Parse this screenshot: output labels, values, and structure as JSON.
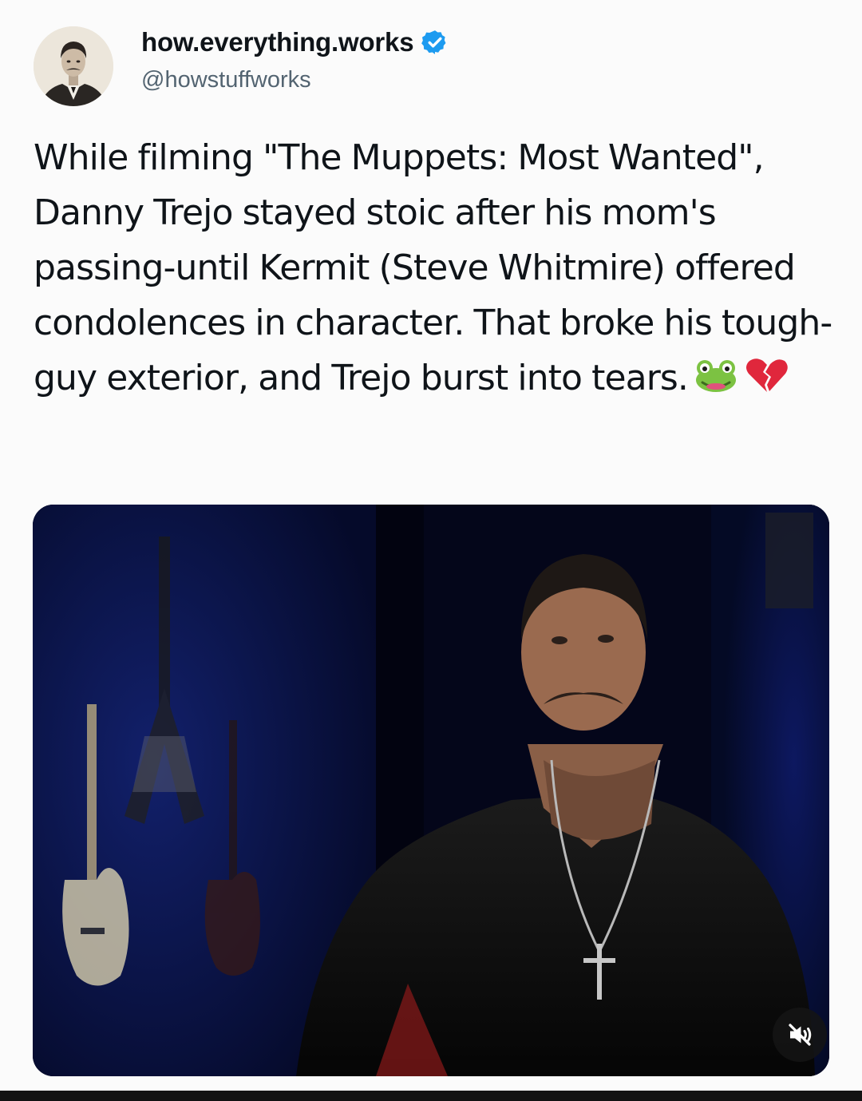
{
  "post": {
    "author": {
      "display_name": "how.everything.works",
      "handle": "@howstuffworks",
      "verified": true,
      "avatar": "vintage-portrait-avatar"
    },
    "text": "While filming \"The Muppets: Most Wanted\", Danny Trejo stayed stoic after his mom's passing-until Kermit (Steve Whitmire) offered condolences in character. That broke his tough-guy exterior, and Trejo burst into tears.",
    "emojis": [
      "frog-emoji",
      "broken-heart-emoji"
    ],
    "media": {
      "type": "video",
      "muted": true,
      "mute_icon": "speaker-muted-icon"
    }
  },
  "colors": {
    "background": "#fbfbfb",
    "text": "#0f1419",
    "secondary_text": "#536471",
    "verified_badge": "#1d9bf0"
  }
}
